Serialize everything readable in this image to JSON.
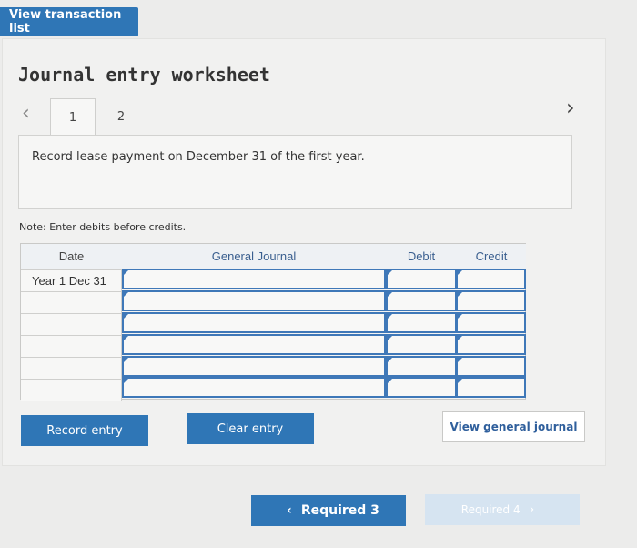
{
  "header": {
    "view_transaction_list": "View transaction list"
  },
  "worksheet": {
    "title": "Journal entry worksheet",
    "tabs": [
      {
        "label": "1"
      },
      {
        "label": "2"
      }
    ],
    "description": "Record lease payment on December 31 of the first year.",
    "note": "Note: Enter debits before credits."
  },
  "grid": {
    "columns": {
      "date": "Date",
      "general_journal": "General Journal",
      "debit": "Debit",
      "credit": "Credit"
    },
    "rows": [
      {
        "date": "Year 1 Dec 31",
        "general_journal": "",
        "debit": "",
        "credit": ""
      },
      {
        "date": "",
        "general_journal": "",
        "debit": "",
        "credit": ""
      },
      {
        "date": "",
        "general_journal": "",
        "debit": "",
        "credit": ""
      },
      {
        "date": "",
        "general_journal": "",
        "debit": "",
        "credit": ""
      },
      {
        "date": "",
        "general_journal": "",
        "debit": "",
        "credit": ""
      },
      {
        "date": "",
        "general_journal": "",
        "debit": "",
        "credit": ""
      }
    ]
  },
  "buttons": {
    "record_entry": "Record entry",
    "clear_entry": "Clear entry",
    "view_general_journal": "View general journal",
    "required_prev": "Required 3",
    "required_next": "Required 4"
  },
  "colors": {
    "primary": "#2f76b6",
    "disabled": "#d6e4f1",
    "cell_border": "#3f78b8"
  }
}
